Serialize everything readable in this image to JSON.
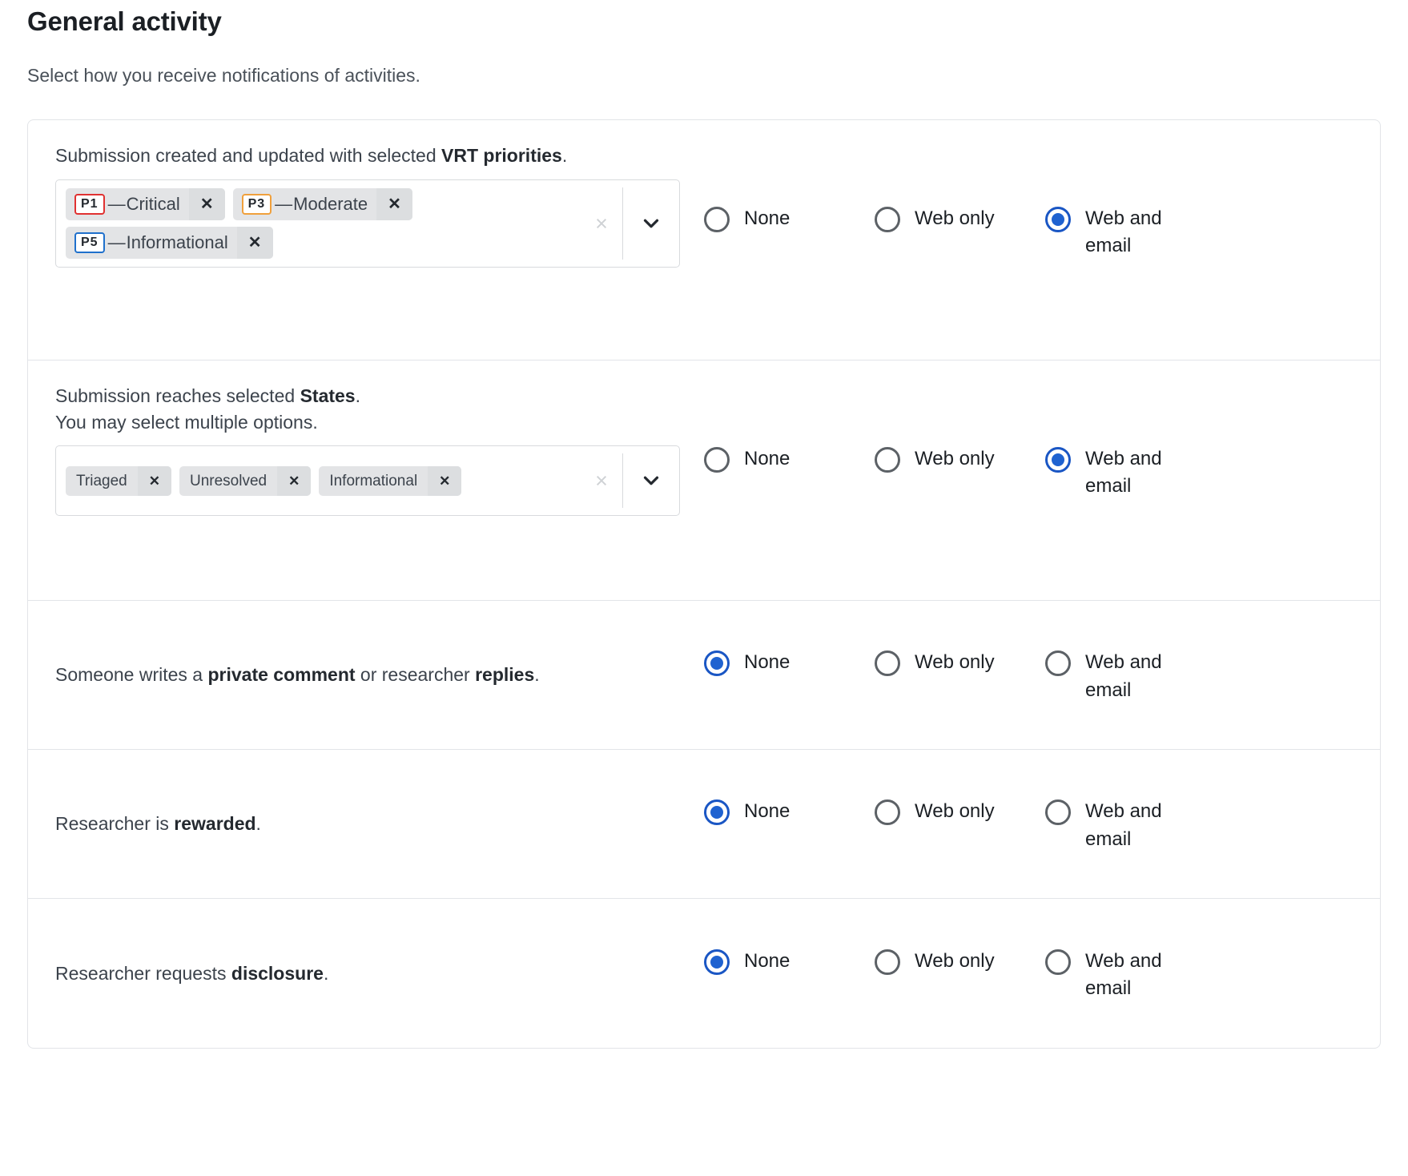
{
  "header": {
    "title": "General activity",
    "subtitle": "Select how you receive notifications of activities."
  },
  "option_labels": {
    "none": "None",
    "web_only": "Web only",
    "web_and_email": "Web and email"
  },
  "icons": {
    "clear": "×",
    "tag_remove": "✕"
  },
  "colors": {
    "accent_blue": "#1f62d0",
    "p1_border": "#e03131",
    "p3_border": "#f0a03c",
    "p5_border": "#1f70cc",
    "radio_unchecked": "#5c6166",
    "tag_bg": "#e3e4e6",
    "panel_border": "#e2e4e8"
  },
  "rows": [
    {
      "id": "submission-created-updated-vrt-priorities",
      "desc_prefix": "Submission created and updated with selected ",
      "desc_bold": "VRT priorities",
      "desc_suffix": ".",
      "sub_text": "",
      "has_select": true,
      "select_name": "vrt-priorities-multiselect",
      "tags": [
        {
          "badge": "P1",
          "badge_color": "#e03131",
          "dash": "—",
          "label": "Critical"
        },
        {
          "badge": "P3",
          "badge_color": "#f0a03c",
          "dash": "—",
          "label": "Moderate"
        },
        {
          "badge": "P5",
          "badge_color": "#1f70cc",
          "dash": "—",
          "label": "Informational"
        }
      ],
      "selected": "web_and_email"
    },
    {
      "id": "submission-reaches-selected-states",
      "desc_prefix": "Submission reaches selected ",
      "desc_bold": "States",
      "desc_suffix": ".",
      "sub_text": "You may select multiple options.",
      "has_select": true,
      "select_name": "states-multiselect",
      "tags": [
        {
          "badge": "",
          "badge_color": "",
          "dash": "",
          "label": "Triaged"
        },
        {
          "badge": "",
          "badge_color": "",
          "dash": "",
          "label": "Unresolved"
        },
        {
          "badge": "",
          "badge_color": "",
          "dash": "",
          "label": "Informational"
        }
      ],
      "selected": "web_and_email"
    },
    {
      "id": "private-comment-or-researcher-replies",
      "desc_prefix": "Someone writes a ",
      "desc_bold": "private comment",
      "desc_mid": " or researcher ",
      "desc_bold2": "replies",
      "desc_suffix": ".",
      "sub_text": "",
      "has_select": false,
      "tags": [],
      "selected": "none"
    },
    {
      "id": "researcher-is-rewarded",
      "desc_prefix": "Researcher is ",
      "desc_bold": "rewarded",
      "desc_suffix": ".",
      "sub_text": "",
      "has_select": false,
      "tags": [],
      "selected": "none"
    },
    {
      "id": "researcher-requests-disclosure",
      "desc_prefix": "Researcher requests ",
      "desc_bold": "disclosure",
      "desc_suffix": ".",
      "sub_text": "",
      "has_select": false,
      "tags": [],
      "selected": "none"
    }
  ]
}
